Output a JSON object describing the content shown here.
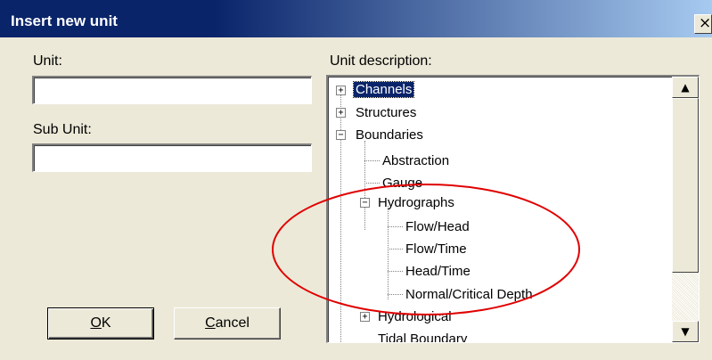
{
  "window": {
    "title": "Insert new unit",
    "close_glyph": "×"
  },
  "form": {
    "unit_label": "Unit:",
    "unit_value": "",
    "sub_unit_label": "Sub Unit:",
    "sub_unit_value": "",
    "description_label": "Unit description:"
  },
  "buttons": {
    "ok_mnemonic": "O",
    "ok_rest": "K",
    "cancel_mnemonic": "C",
    "cancel_rest": "ancel"
  },
  "tree": {
    "items": [
      {
        "label": "Channels",
        "expander": "+",
        "selected": true
      },
      {
        "label": "Structures",
        "expander": "+"
      },
      {
        "label": "Boundaries",
        "expander": "−"
      },
      {
        "label": "Abstraction"
      },
      {
        "label": "Gauge"
      },
      {
        "label": "Hydrographs",
        "expander": "−"
      },
      {
        "label": "Flow/Head"
      },
      {
        "label": "Flow/Time"
      },
      {
        "label": "Head/Time"
      },
      {
        "label": "Normal/Critical Depth"
      },
      {
        "label": "Hydrological",
        "expander": "+"
      },
      {
        "label": "Tidal Boundary"
      }
    ]
  },
  "scrollbar": {
    "up_glyph": "▲",
    "down_glyph": "▼"
  },
  "colors": {
    "selection": "#0a246a",
    "annotation_ellipse": "#e00000"
  }
}
